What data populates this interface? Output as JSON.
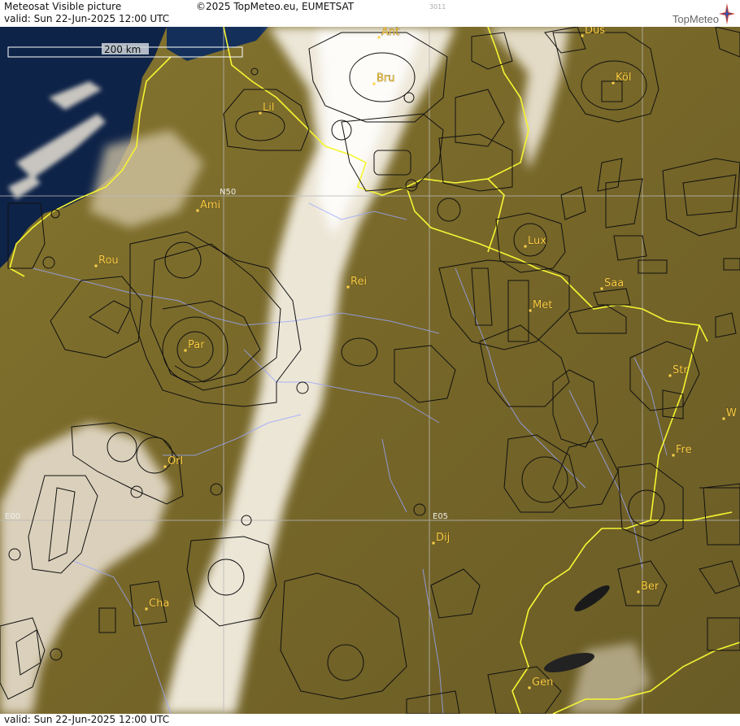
{
  "header": {
    "title": "Meteosat Visible picture",
    "copyright": "©2025 TopMeteo.eu, EUMETSAT",
    "code": "3011",
    "valid": "valid:  Sun  22-Jun-2025  12:00 UTC",
    "logo": "TopMeteo"
  },
  "footer": {
    "valid": "valid:  Sun  22-Jun-2025  12:00 UTC"
  },
  "scale": {
    "label": "200 km"
  },
  "grid_labels": {
    "n50": "N50",
    "e00": "E00",
    "e05": "E05"
  },
  "cities": [
    {
      "name": "Ant"
    },
    {
      "name": "Düs"
    },
    {
      "name": "Bru"
    },
    {
      "name": "Köl"
    },
    {
      "name": "Lil"
    },
    {
      "name": "Ami"
    },
    {
      "name": "Lux"
    },
    {
      "name": "Rou"
    },
    {
      "name": "Rei"
    },
    {
      "name": "Saa"
    },
    {
      "name": "Met"
    },
    {
      "name": "Par"
    },
    {
      "name": "Str"
    },
    {
      "name": "W"
    },
    {
      "name": "Fre"
    },
    {
      "name": "Orl"
    },
    {
      "name": "Dij"
    },
    {
      "name": "Ber"
    },
    {
      "name": "Cha"
    },
    {
      "name": "Gen"
    }
  ],
  "colors": {
    "land": "#7a6a2a",
    "sea": "#0e2348",
    "cloud": "#f2ede0",
    "border": "#f5f532",
    "airspace": "#111111",
    "river": "#9aa6ff",
    "city": "#ffd24a"
  }
}
